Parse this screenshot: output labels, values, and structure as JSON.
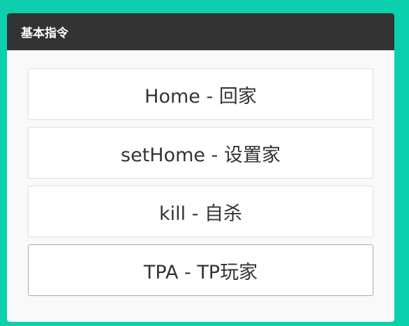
{
  "panel": {
    "title": "基本指令"
  },
  "commands": [
    {
      "label": "Home - 回家"
    },
    {
      "label": "setHome - 设置家"
    },
    {
      "label": "kill - 自杀"
    },
    {
      "label": "TPA - TP玩家"
    }
  ],
  "colors": {
    "background": "#0ccfae",
    "header": "#333333",
    "panel": "#f9f9f9"
  }
}
